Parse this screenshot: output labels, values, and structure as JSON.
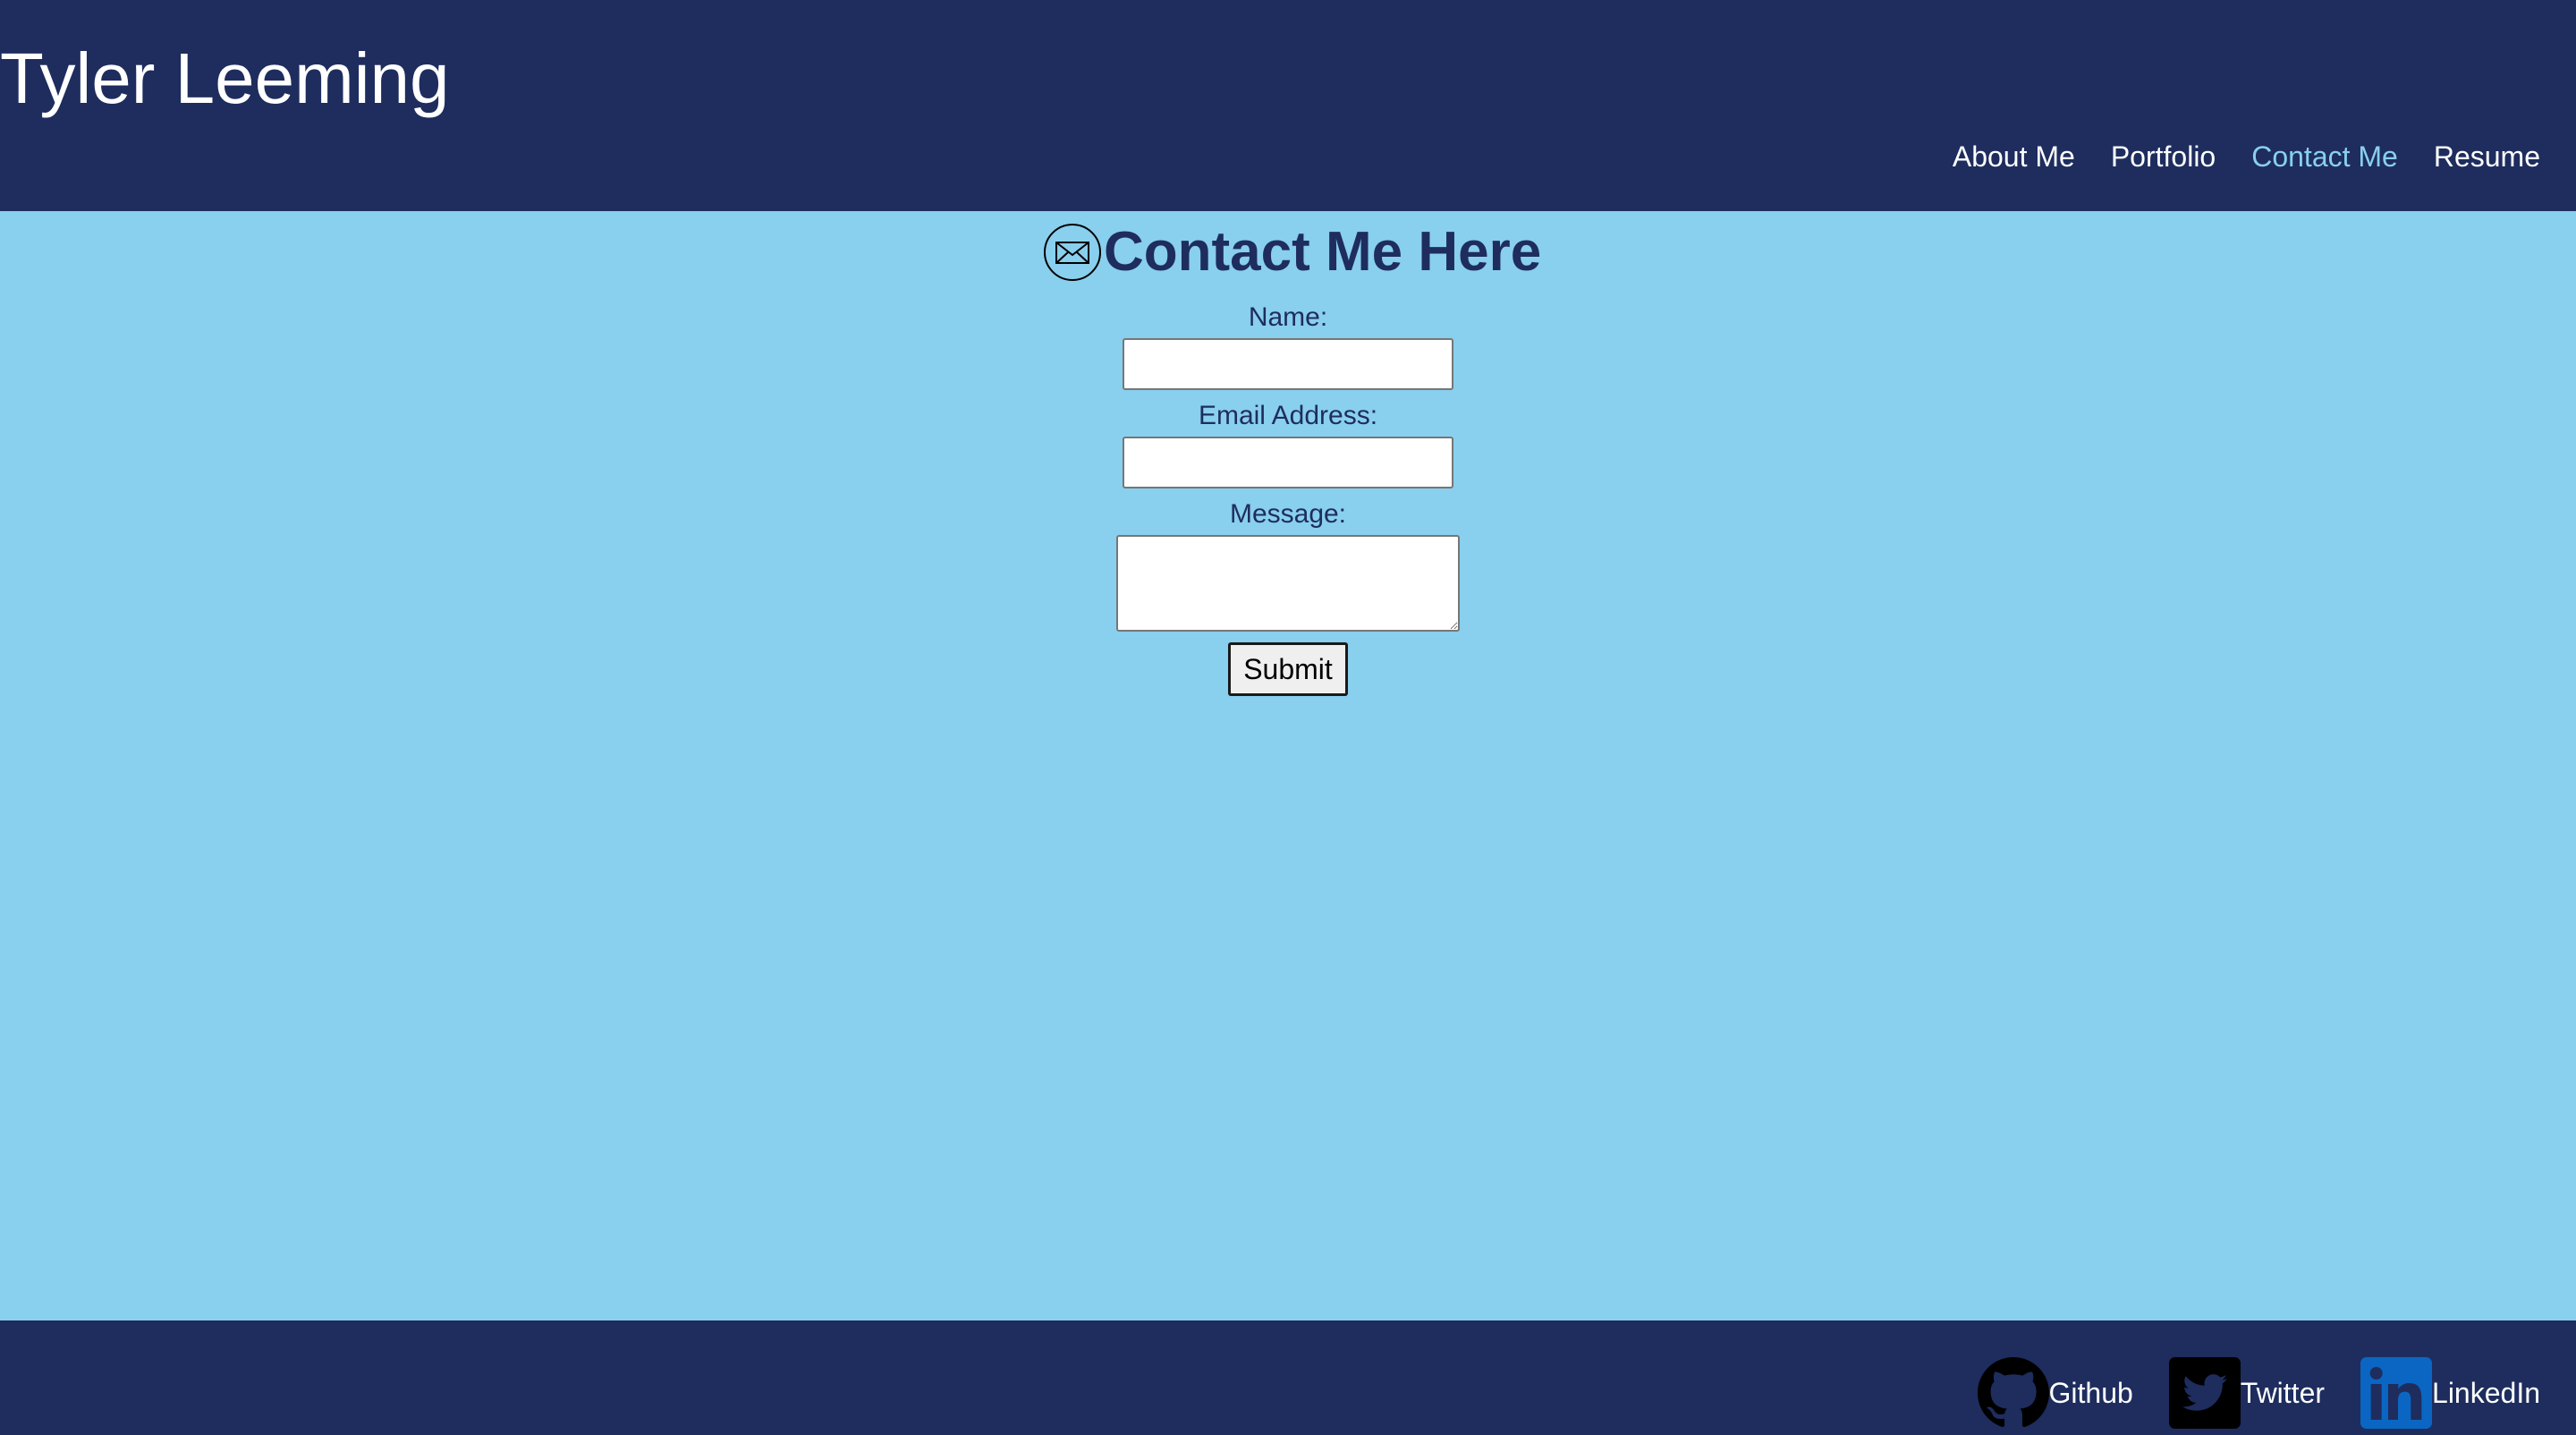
{
  "header": {
    "title": "Tyler Leeming",
    "nav": [
      {
        "label": "About Me",
        "active": false
      },
      {
        "label": "Portfolio",
        "active": false
      },
      {
        "label": "Contact Me",
        "active": true
      },
      {
        "label": "Resume",
        "active": false
      }
    ]
  },
  "contact": {
    "icon": "envelope-icon",
    "heading": "Contact Me Here",
    "name_label": "Name:",
    "name_value": "",
    "email_label": "Email Address:",
    "email_value": "",
    "message_label": "Message:",
    "message_value": "",
    "submit_label": "Submit"
  },
  "footer": {
    "links": [
      {
        "label": "Github",
        "icon": "github-icon"
      },
      {
        "label": "Twitter",
        "icon": "twitter-icon"
      },
      {
        "label": "LinkedIn",
        "icon": "linkedin-icon"
      }
    ]
  },
  "colors": {
    "header_bg": "#1E2D5E",
    "page_bg": "#89CFEE",
    "active_nav": "#89CFEE",
    "heading_text": "#1E2D5E",
    "linkedin_blue": "#0A66C2"
  }
}
